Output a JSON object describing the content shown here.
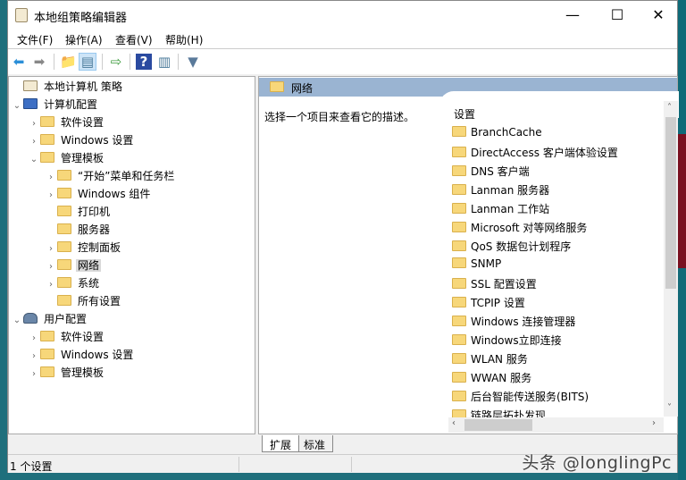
{
  "window": {
    "title": "本地组策略编辑器",
    "minimize": "—",
    "maximize": "☐",
    "close": "✕"
  },
  "menu": [
    "文件(F)",
    "操作(A)",
    "查看(V)",
    "帮助(H)"
  ],
  "toolbar": [
    {
      "icon": "back-icon",
      "glyph": "⬅",
      "color": "#2b8fd8"
    },
    {
      "icon": "forward-icon",
      "glyph": "➡",
      "color": "#888888"
    },
    {
      "icon": "up-folder-icon",
      "glyph": "📁",
      "color": "#d9a520"
    },
    {
      "icon": "show-hide-tree-icon",
      "glyph": "▤",
      "color": "#4a7a9a"
    },
    {
      "icon": "export-list-icon",
      "glyph": "⇨",
      "color": "#3a9a3a"
    },
    {
      "icon": "help-icon",
      "glyph": "?",
      "color": "#2a4aa0"
    },
    {
      "icon": "show-action-pane-icon",
      "glyph": "▥",
      "color": "#4a7a9a"
    },
    {
      "icon": "filter-icon",
      "glyph": "▼",
      "color": "#5a7a9a"
    }
  ],
  "tree": [
    {
      "label": "本地计算机 策略",
      "level": 0,
      "chev": "",
      "icon": "policy-icon"
    },
    {
      "label": "计算机配置",
      "level": 0,
      "chev": "⌄",
      "icon": "computer-icon"
    },
    {
      "label": "软件设置",
      "level": 1,
      "chev": "›",
      "icon": "folder"
    },
    {
      "label": "Windows 设置",
      "level": 1,
      "chev": "›",
      "icon": "folder"
    },
    {
      "label": "管理模板",
      "level": 1,
      "chev": "⌄",
      "icon": "folder"
    },
    {
      "label": "“开始”菜单和任务栏",
      "level": 2,
      "chev": "›",
      "icon": "folder"
    },
    {
      "label": "Windows 组件",
      "level": 2,
      "chev": "›",
      "icon": "folder"
    },
    {
      "label": "打印机",
      "level": 2,
      "chev": "",
      "icon": "folder"
    },
    {
      "label": "服务器",
      "level": 2,
      "chev": "",
      "icon": "folder"
    },
    {
      "label": "控制面板",
      "level": 2,
      "chev": "›",
      "icon": "folder"
    },
    {
      "label": "网络",
      "level": 2,
      "chev": "›",
      "icon": "folder",
      "selected": true
    },
    {
      "label": "系统",
      "level": 2,
      "chev": "›",
      "icon": "folder"
    },
    {
      "label": "所有设置",
      "level": 2,
      "chev": "",
      "icon": "all-settings-icon"
    },
    {
      "label": "用户配置",
      "level": 0,
      "chev": "⌄",
      "icon": "user-icon"
    },
    {
      "label": "软件设置",
      "level": 1,
      "chev": "›",
      "icon": "folder"
    },
    {
      "label": "Windows 设置",
      "level": 1,
      "chev": "›",
      "icon": "folder"
    },
    {
      "label": "管理模板",
      "level": 1,
      "chev": "›",
      "icon": "folder"
    }
  ],
  "right": {
    "header": "网络",
    "description": "选择一个项目来查看它的描述。",
    "column": "设置",
    "items": [
      "BranchCache",
      "DirectAccess 客户端体验设置",
      "DNS 客户端",
      "Lanman 服务器",
      "Lanman 工作站",
      "Microsoft 对等网络服务",
      "QoS 数据包计划程序",
      "SNMP",
      "SSL 配置设置",
      "TCPIP 设置",
      "Windows 连接管理器",
      "Windows立即连接",
      "WLAN 服务",
      "WWAN 服务",
      "后台智能传送服务(BITS)",
      "链路层拓扑发现"
    ]
  },
  "tabs": [
    "扩展",
    "标准"
  ],
  "status": "1 个设置",
  "watermark": "头条 @longlingPc"
}
